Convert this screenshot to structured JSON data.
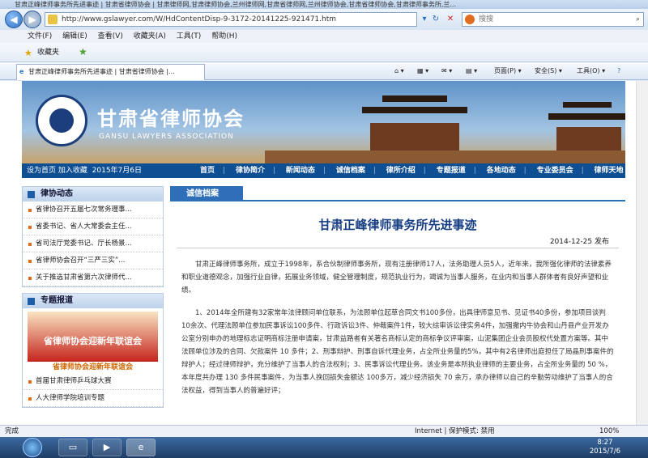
{
  "window": {
    "title": "甘肃正峰律师事务所先进事迹 | 甘肃省律师协会 | 甘肃律师网,甘肃律师协会,兰州律师网,甘肃省律师网,兰州律师协会,甘肃省律师协会,甘肃律师事务所,兰..."
  },
  "toolbar": {
    "back_icon": "back-arrow-icon",
    "address": "http://www.gslawyer.com/W/HdContentDisp-9-3172-20141225-921471.htm",
    "search_placeholder": "搜搜"
  },
  "menu": [
    "文件(F)",
    "编辑(E)",
    "查看(V)",
    "收藏夹(A)",
    "工具(T)",
    "帮助(H)"
  ],
  "favorites": {
    "label": "收藏夹"
  },
  "tab": {
    "label": "甘肃正峰律师事务所先进事迹 | 甘肃省律师协会 |..."
  },
  "commands": {
    "page": "页面(P) ▾",
    "safety": "安全(S) ▾",
    "tools": "工具(O) ▾",
    "help": "?"
  },
  "site": {
    "logo_cn": "甘肃省律师协会",
    "logo_en": "GANSU LAWYERS ASSOCIATION",
    "set_home": "设为首页",
    "add_fav": "加入收藏",
    "date": "2015年7月6日",
    "nav": [
      "首页",
      "律协简介",
      "新闻动态",
      "诚信档案",
      "律所介绍",
      "专题报道",
      "各地动态",
      "专业委员会",
      "律师天地"
    ]
  },
  "sidebar": {
    "news_title": "律协动态",
    "news": [
      "省律协召开五届七次常务理事...",
      "省委书记、省人大常委会主任...",
      "省司法厅党委书记、厅长杨景...",
      "省律师协会召开“三严三实”...",
      "关于推选甘肃省第六次律师代..."
    ],
    "topics_title": "专题报道",
    "banner_text": "省律师协会迎新年联谊会",
    "banner_caption": "省律师协会迎新年联谊会",
    "topics": [
      "首届甘肃律师乒乓球大赛",
      "人大律师学院培训专题"
    ]
  },
  "article": {
    "section": "诚信档案",
    "title": "甘肃正峰律师事务所先进事迹",
    "date": "2014-12-25 发布",
    "p1": "甘肃正峰律师事务所，成立于1998年，系合伙制律师事务所，现有注册律师17人，法务助理人员5人，近年来，我所强化律师的法律素养和职业道德观念，加强行业自律，拓展业务领域，健全管理制度，规范执业行为，竭诚为当事人服务，在业内和当事人群体者有良好声望和业绩。",
    "p2": "1、2014年全所建有32家常年法律顾问单位联系，为法顾单位起草合同文书100多份，出具律师意见书、见证书40多份，参加项目谈判10余次、代理法顾单位参加民事诉讼100多件、行政诉讼3件、仲裁案件1件，较大综审诉讼律实务4件，加强撤内牛协会和山丹县产业开发办公室分别申办的地理标志证明商标注册申请案，甘肃益路者有关著名商标认定的商标争议评审案，山泥集团企业会员股权代处置方案等。其中法顾单位涉及的合同、欠款案件 10 多件；2、刑事辩护、刑事自诉代理业务，占全所业务量的5%，其中有2名律师出庭担任了局晶刑事案件的辩护人；经过律师辩护，充分维护了当事人的合法权利；3、民事诉讼代理业务。该业务是本所执业律师的主要业务，占全所业务量的 50 %，本年度共办理  130 多件民事案件，为当事人挽回损失金额达 100多万，减少经济损失  70 余万，承办律师以自己的辛勤劳动维护了当事人的合法权益，得到当事人的普遍好评；"
  },
  "status": {
    "left": "完成",
    "zone": "Internet | 保护模式: 禁用",
    "zoom": "100%"
  },
  "taskbar": {
    "time": "8:27",
    "date": "2015/7/6"
  }
}
